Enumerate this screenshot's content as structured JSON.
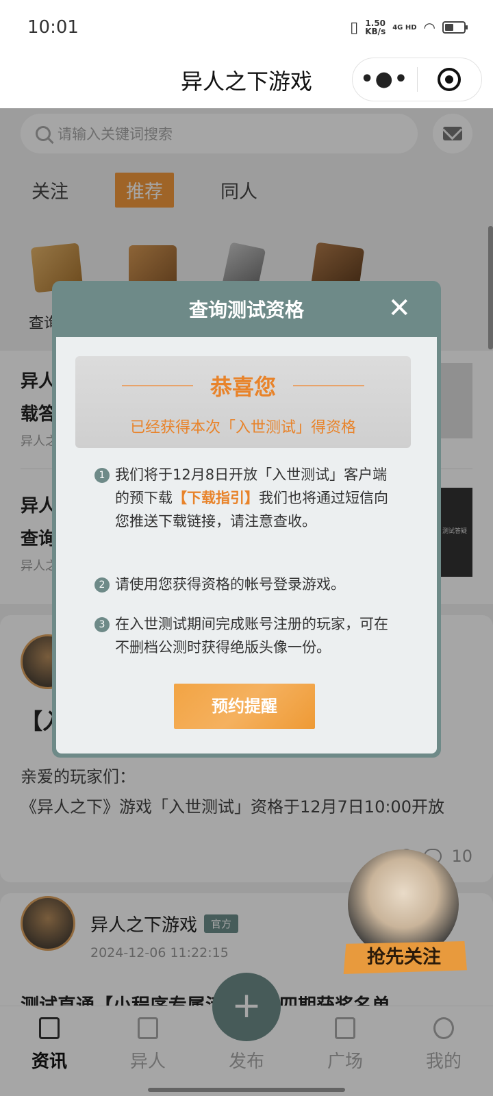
{
  "status_bar": {
    "time": "10:01",
    "speed_value": "1.50",
    "speed_unit": "KB/s",
    "network": "4G HD"
  },
  "title_bar": {
    "title": "异人之下游戏",
    "more_label": "•●•"
  },
  "search": {
    "placeholder": "请输入关键词搜索"
  },
  "tabs": [
    {
      "label": "关注",
      "active": false
    },
    {
      "label": "推荐",
      "active": true
    },
    {
      "label": "同人",
      "active": false
    }
  ],
  "shortcut_label_partial": "查询",
  "news": [
    {
      "line1": "异人",
      "line2": "载答",
      "sub": "异人之"
    },
    {
      "line1": "异人",
      "line2": "查询",
      "sub": "异人之"
    }
  ],
  "thumb_caption": "测试答疑",
  "card": {
    "title_partial": "【入",
    "greeting": "亲爱的玩家们：",
    "text": "《异人之下》游戏「入世测试」资格于12月7日10:00开放",
    "comment_count": "10"
  },
  "post": {
    "author": "异人之下游戏",
    "badge": "官方",
    "date": "2024-12-06 11:22:15",
    "title": "测试直通【小程序专属活动】第四期获奖名单"
  },
  "promo": {
    "label": "抢先关注"
  },
  "bottom_nav": [
    {
      "label": "资讯",
      "active": true
    },
    {
      "label": "异人",
      "active": false
    },
    {
      "label": "发布",
      "active": false
    },
    {
      "label": "广场",
      "active": false
    },
    {
      "label": "我的",
      "active": false
    }
  ],
  "publish_symbol": "+",
  "modal": {
    "title": "查询测试资格",
    "close_symbol": "✕",
    "congrats_title": "恭喜您",
    "congrats_sub": "已经获得本次「入世测试」得资格",
    "rules": [
      {
        "num": "1",
        "text_a": "我们将于12月8日开放「入世测试」客户端的预下载",
        "link": "【下载指引】",
        "text_b": "我们也将通过短信向您推送下载链接，请注意查收。"
      },
      {
        "num": "2",
        "text_a": "请使用您获得资格的帐号登录游戏。"
      },
      {
        "num": "3",
        "text_a": "在入世测试期间完成账号注册的玩家，可在不删档公测时获得绝版头像一份。"
      }
    ],
    "button": "预约提醒"
  },
  "colors": {
    "accent_orange": "#f59a3c",
    "modal_teal": "#6e8a88",
    "text_orange": "#e8832a"
  }
}
